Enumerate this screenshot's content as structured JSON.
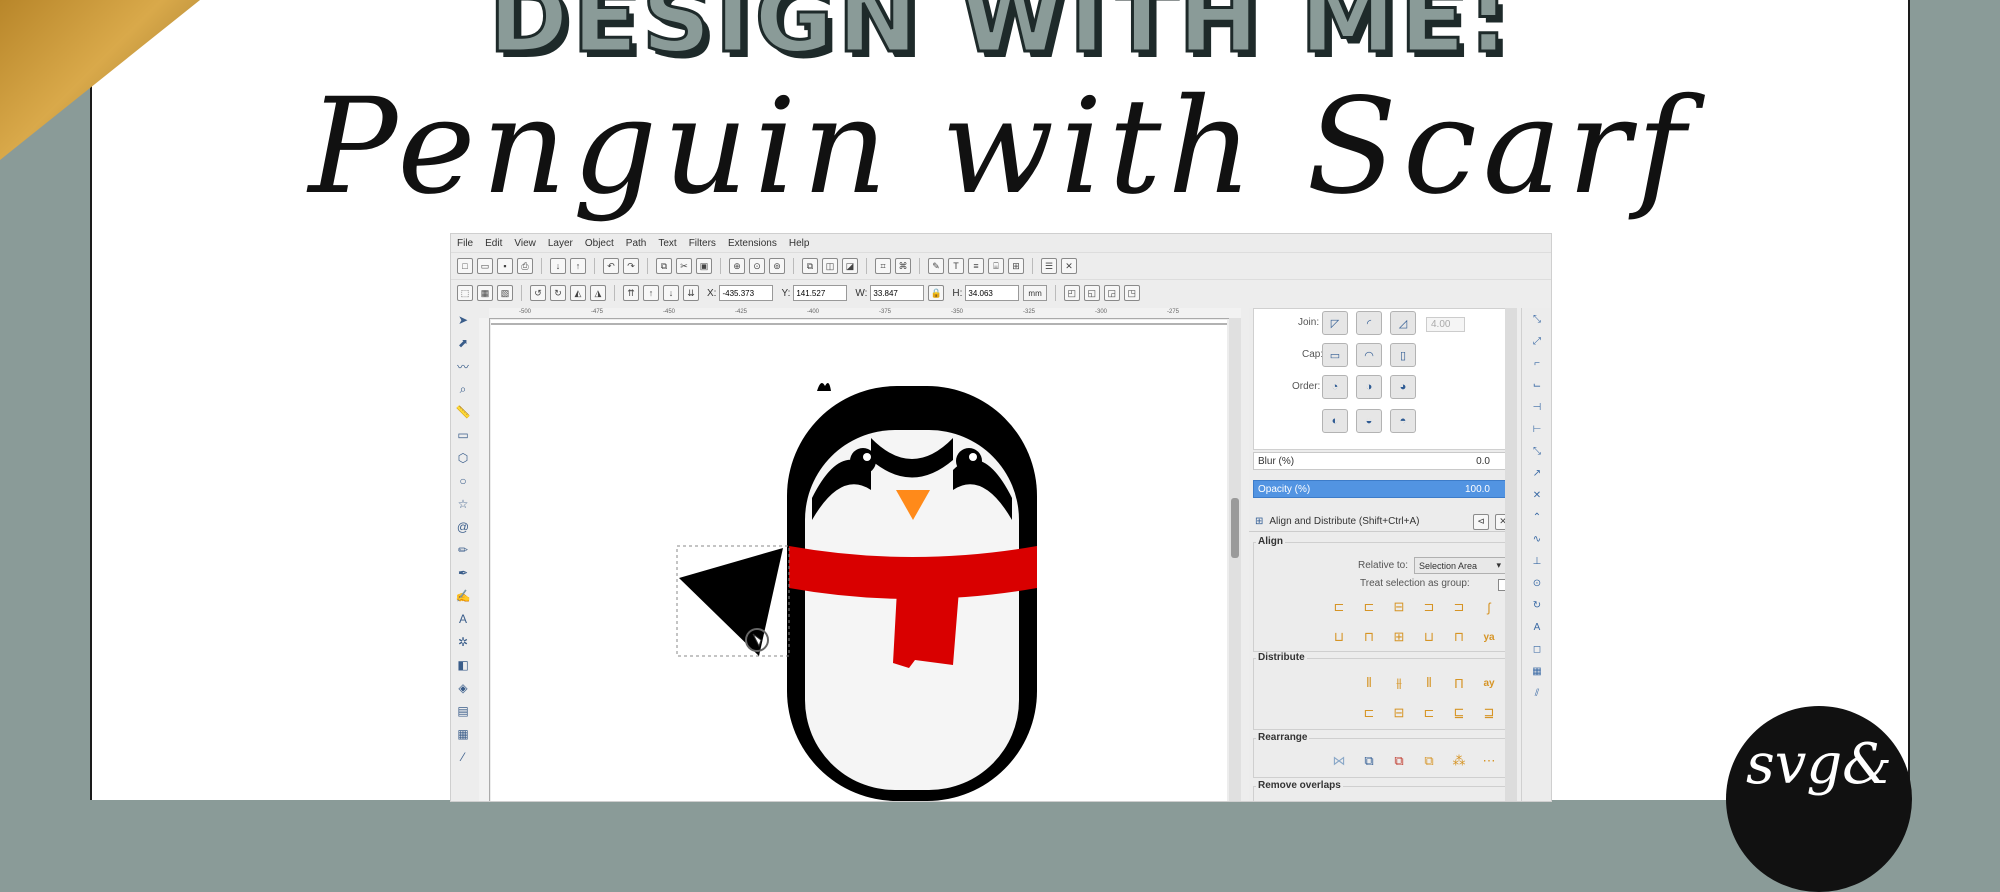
{
  "header": {
    "title_line1": "DESIGN WITH ME:",
    "title_line2": "Penguin with Scarf"
  },
  "colors": {
    "frame_bg": "#8a9b98",
    "accent_gold": "#c8982f",
    "selection_blue": "#5294e2",
    "scarf_red": "#d90000",
    "beak_orange": "#ff8a1a"
  },
  "app": {
    "menu": [
      "File",
      "Edit",
      "View",
      "Layer",
      "Object",
      "Path",
      "Text",
      "Filters",
      "Extensions",
      "Help"
    ],
    "toolbar": {
      "x_label": "X:",
      "x_value": "-435.373",
      "y_label": "Y:",
      "y_value": "141.527",
      "w_label": "W:",
      "w_value": "33.847",
      "h_label": "H:",
      "h_value": "34.063",
      "unit": "mm"
    },
    "ruler_ticks": [
      "-500",
      "-475",
      "-450",
      "-425",
      "-400",
      "-375",
      "-350",
      "-325",
      "-300",
      "-275"
    ],
    "stroke_panel": {
      "join_label": "Join:",
      "miter_value": "4.00",
      "cap_label": "Cap:",
      "order_label": "Order:"
    },
    "blur": {
      "label": "Blur (%)",
      "value": "0.0"
    },
    "opacity": {
      "label": "Opacity (%)",
      "value": "100.0"
    },
    "align_panel": {
      "title": "Align and Distribute (Shift+Ctrl+A)",
      "align_label": "Align",
      "relative_label": "Relative to:",
      "relative_value": "Selection Area",
      "treat_group_label": "Treat selection as group:",
      "distribute_label": "Distribute",
      "rearrange_label": "Rearrange",
      "remove_overlaps_label": "Remove overlaps"
    }
  },
  "logo": {
    "text": "svg&"
  }
}
